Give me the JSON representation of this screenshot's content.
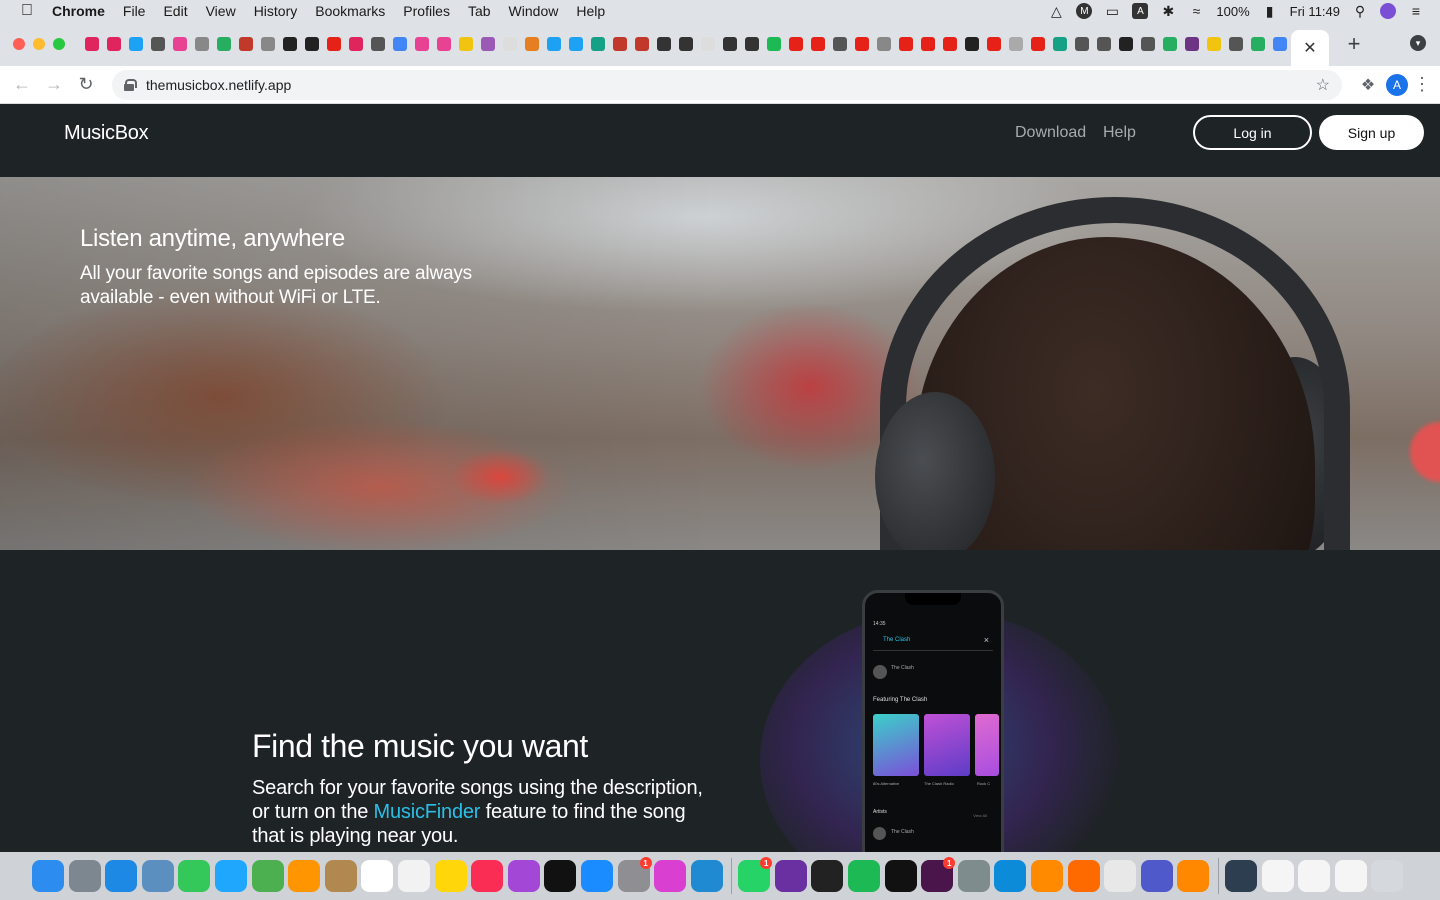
{
  "menubar": {
    "app_name": "Chrome",
    "items": [
      "File",
      "Edit",
      "View",
      "History",
      "Bookmarks",
      "Profiles",
      "Tab",
      "Window",
      "Help"
    ],
    "battery": "100%",
    "clock": "Fri 11:49"
  },
  "browser": {
    "url": "themusicbox.netlify.app",
    "profile_initial": "A",
    "active_tab_close": "✕",
    "new_tab_symbol": "+"
  },
  "site": {
    "logo": "MusicBox",
    "nav": {
      "download": "Download",
      "help": "Help",
      "login": "Log in",
      "signup": "Sign up"
    },
    "hero": {
      "title": "Listen anytime, anywhere",
      "subtitle": "All your favorite songs and episodes are always available - even without WiFi or LTE."
    },
    "feature": {
      "title": "Find the music you want",
      "text_before": "Search for your favorite songs using the description, or turn on the ",
      "highlight": "MusicFinder",
      "text_after": " feature to find the song that is playing near you."
    },
    "phone": {
      "time": "14:35",
      "search_value": "The Clash",
      "artist_row": "The Clash",
      "section_title": "Featuring The Clash",
      "card_captions": [
        "80s Alternative",
        "The Clash Radio",
        "Rock C"
      ],
      "artists_label": "Artists",
      "view_all": "View All",
      "artist_row_2": "The Clash"
    }
  },
  "colors": {
    "page_bg": "#1e2326",
    "accent": "#2bbfe6",
    "nav_link": "#a6abb0"
  },
  "dock": {
    "notification_badges": [
      "1",
      "1",
      "1"
    ]
  }
}
